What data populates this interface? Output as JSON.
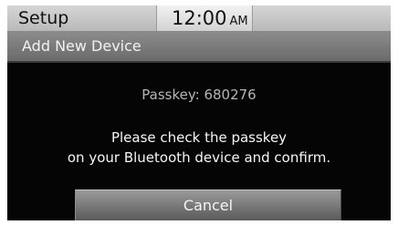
{
  "status_bar": {
    "title": "Setup",
    "time": "12:00",
    "ampm": "AM"
  },
  "title_bar": {
    "title": "Add New Device"
  },
  "dialog": {
    "passkey": "Passkey: 680276",
    "message_line1": "Please check the passkey",
    "message_line2": "on your Bluetooth device and confirm.",
    "cancel_label": "Cancel"
  },
  "colors": {
    "background": "#050505",
    "status_bar": "#c8c8c8",
    "title_bar": "#7a7a7a",
    "button": "#7a7a7a",
    "passkey_text": "#b5b5b5",
    "message_text": "#f5f5f5"
  }
}
